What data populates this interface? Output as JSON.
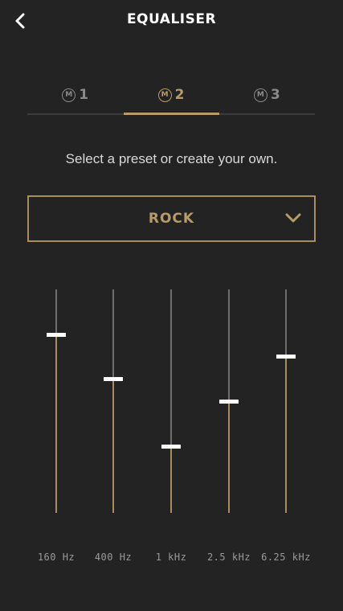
{
  "header": {
    "back_icon": "chevron-left-icon",
    "title": "EQUALISER"
  },
  "tabs": [
    {
      "badge": "M",
      "label": "1",
      "active": false
    },
    {
      "badge": "M",
      "label": "2",
      "active": true
    },
    {
      "badge": "M",
      "label": "3",
      "active": false
    }
  ],
  "hint": "Select a preset or create your own.",
  "preset": {
    "value": "ROCK",
    "icon": "chevron-down-icon"
  },
  "bands": [
    {
      "label": "160 Hz",
      "level": 0.8
    },
    {
      "label": "400 Hz",
      "level": 0.6
    },
    {
      "label": "1 kHz",
      "level": 0.3
    },
    {
      "label": "2.5 kHz",
      "level": 0.5
    },
    {
      "label": "6.25 kHz",
      "level": 0.7
    }
  ],
  "colors": {
    "accent": "#b89b66",
    "background": "#232323",
    "track_inactive": "#6e6e6e",
    "thumb": "#ffffff"
  }
}
